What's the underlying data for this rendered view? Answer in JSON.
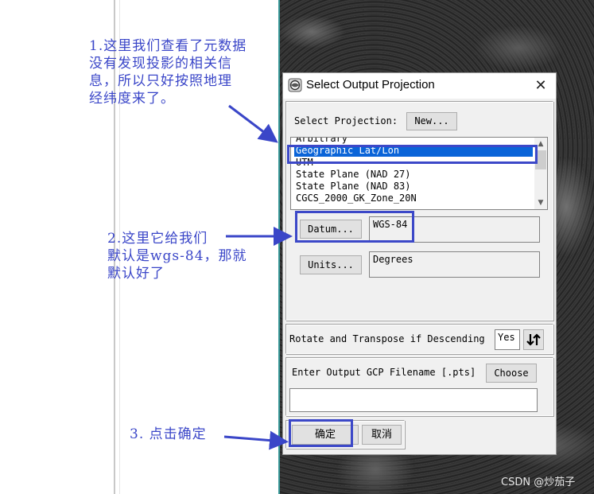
{
  "annotations": {
    "note1": "1.这里我们查看了元数据\n没有发现投影的相关信\n息，所以只好按照地理\n经纬度来了。",
    "note2": "2.这里它给我们\n默认是wgs-84，那就\n默认好了",
    "note3": "3. 点击确定"
  },
  "dialog": {
    "title": "Select Output Projection",
    "close_glyph": "✕",
    "select_projection_label": "Select Projection:",
    "new_button": "New...",
    "projection_list": [
      "Arbitrary",
      "Geographic Lat/Lon",
      "UTM",
      "State Plane (NAD 27)",
      "State Plane (NAD 83)",
      "CGCS_2000_GK_Zone_20N"
    ],
    "selected_projection": "Geographic Lat/Lon",
    "datum_button": "Datum...",
    "datum_value": "WGS-84",
    "units_button": "Units...",
    "units_value": "Degrees",
    "rotate_label": "Rotate and Transpose if Descending",
    "rotate_value": "Yes",
    "gcp_label": "Enter Output GCP Filename [.pts]",
    "choose_button": "Choose",
    "gcp_filename": "",
    "ok_button": "确定",
    "cancel_button": "取消"
  },
  "watermark": "CSDN @炒茄子",
  "colors": {
    "annotation": "#3a46c8",
    "selection": "#0a64d8",
    "dialog_bg": "#f0f0f0"
  },
  "icons": {
    "title": "envi-globe-icon",
    "close": "close-icon",
    "sort": "sort-arrows-icon",
    "scroll_up": "chevron-up-icon",
    "scroll_down": "chevron-down-icon"
  }
}
